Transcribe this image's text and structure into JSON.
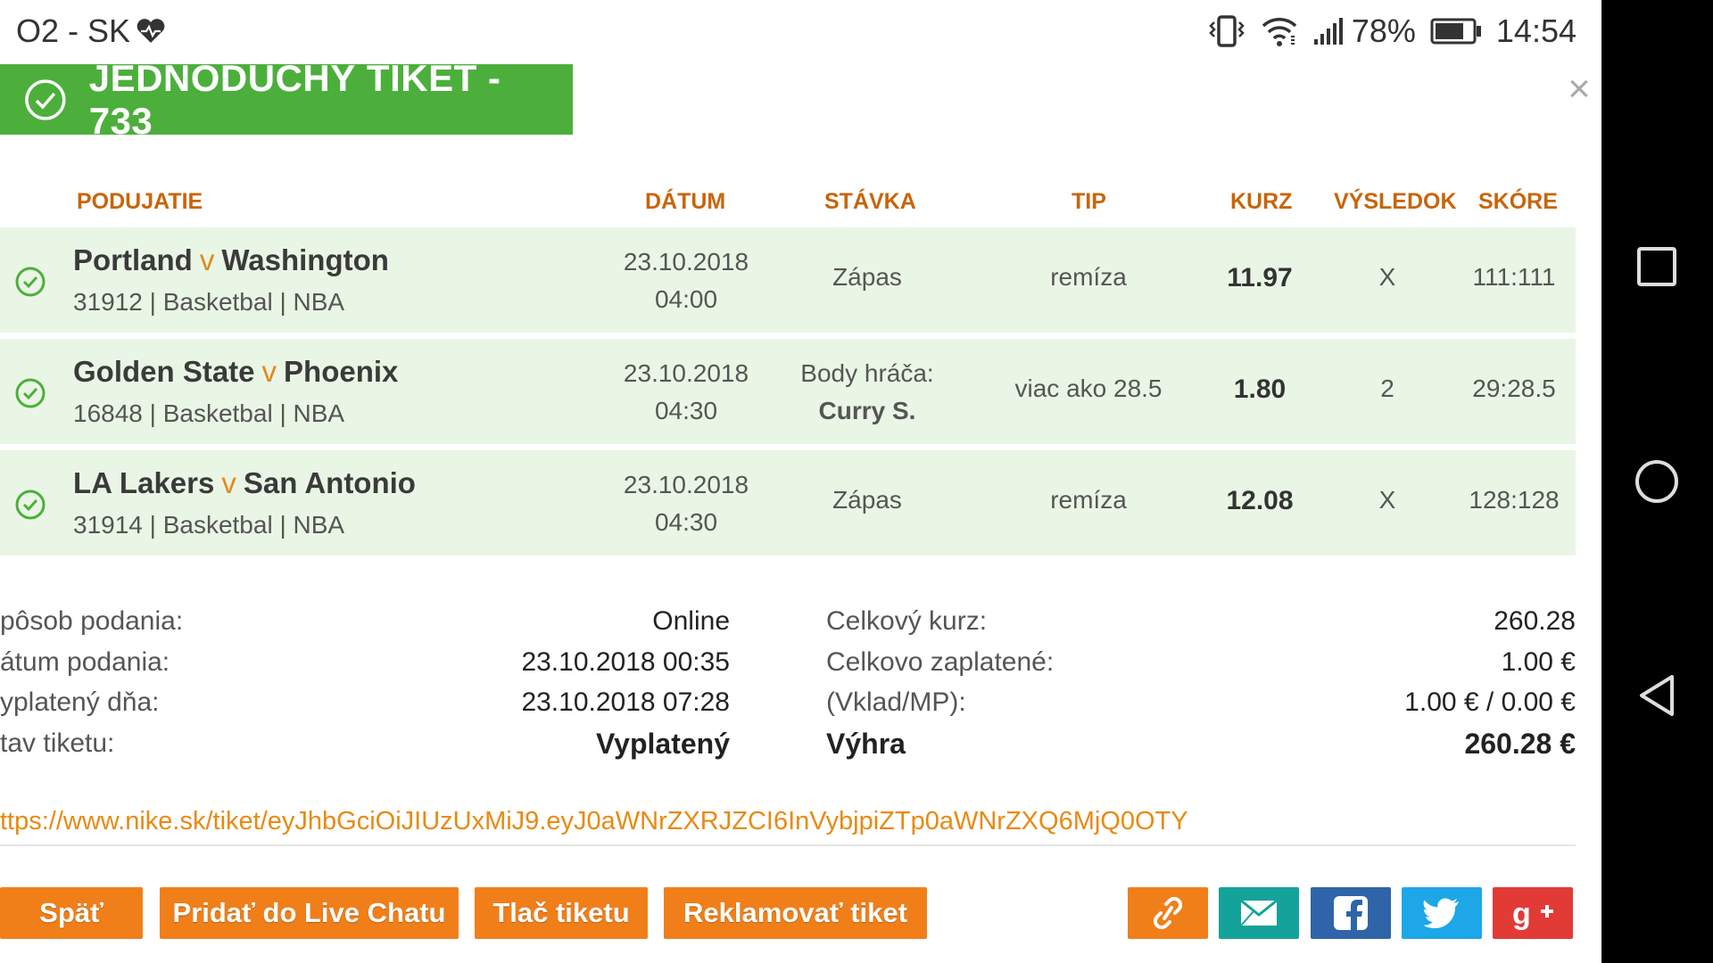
{
  "status_bar": {
    "carrier": "O2 - SK",
    "battery_percent": "78%",
    "time": "14:54",
    "battery_level": 0.78
  },
  "ticket": {
    "title": "JEDNODUCHÝ TIKET - 733",
    "close_symbol": "×",
    "accent_color": "#4caf3c"
  },
  "table": {
    "headers": {
      "event": "PODUJATIE",
      "date": "DÁTUM",
      "bet": "STÁVKA",
      "tip": "TIP",
      "odds": "KURZ",
      "result": "VÝSLEDOK",
      "score": "SKÓRE"
    },
    "rows": [
      {
        "team_home": "Portland",
        "vs": "v",
        "team_away": "Washington",
        "meta": "31912 | Basketbal | NBA",
        "date": "23.10.2018",
        "time": "04:00",
        "bet": "Zápas",
        "bet_sub": "",
        "tip": "remíza",
        "odds": "11.97",
        "result": "X",
        "score": "111:111"
      },
      {
        "team_home": "Golden State",
        "vs": "v",
        "team_away": "Phoenix",
        "meta": "16848 | Basketbal | NBA",
        "date": "23.10.2018",
        "time": "04:30",
        "bet": "Body hráča:",
        "bet_sub": "Curry S.",
        "tip": "viac ako 28.5",
        "odds": "1.80",
        "result": "2",
        "score": "29:28.5"
      },
      {
        "team_home": "LA Lakers",
        "vs": "v",
        "team_away": "San Antonio",
        "meta": "31914 | Basketbal | NBA",
        "date": "23.10.2018",
        "time": "04:30",
        "bet": "Zápas",
        "bet_sub": "",
        "tip": "remíza",
        "odds": "12.08",
        "result": "X",
        "score": "128:128"
      }
    ]
  },
  "summary": {
    "left": [
      {
        "label": "pôsob podania:",
        "value": "Online"
      },
      {
        "label": "átum podania:",
        "value": "23.10.2018 00:35"
      },
      {
        "label": "yplatený dňa:",
        "value": "23.10.2018 07:28"
      },
      {
        "label": "tav tiketu:",
        "value": "Vyplatený"
      }
    ],
    "right": [
      {
        "label": "Celkový kurz:",
        "value": "260.28"
      },
      {
        "label": "Celkovo zaplatené:",
        "value": "1.00 €"
      },
      {
        "label": "(Vklad/MP):",
        "value": "1.00 € / 0.00 €"
      },
      {
        "label": "Výhra",
        "value": "260.28 €"
      }
    ]
  },
  "ticket_link": "ttps://www.nike.sk/tiket/eyJhbGciOiJIUzUxMiJ9.eyJ0aWNrZXRJZCI6InVybjpiZTp0aWNrZXQ6MjQ0OTY",
  "actions": {
    "back": "Späť",
    "add_live_chat": "Pridať do Live Chatu",
    "print": "Tlač tiketu",
    "complaint": "Reklamovať tiket"
  },
  "share": {
    "link_icon": "link-icon",
    "email_icon": "email-icon",
    "facebook_icon": "facebook-icon",
    "twitter_icon": "twitter-icon",
    "google_plus_icon": "google-plus-icon",
    "colors": {
      "link": "#f07f1a",
      "email": "#14a39a",
      "facebook": "#2f65a8",
      "twitter": "#1da7e8",
      "google_plus": "#e23b36"
    }
  }
}
